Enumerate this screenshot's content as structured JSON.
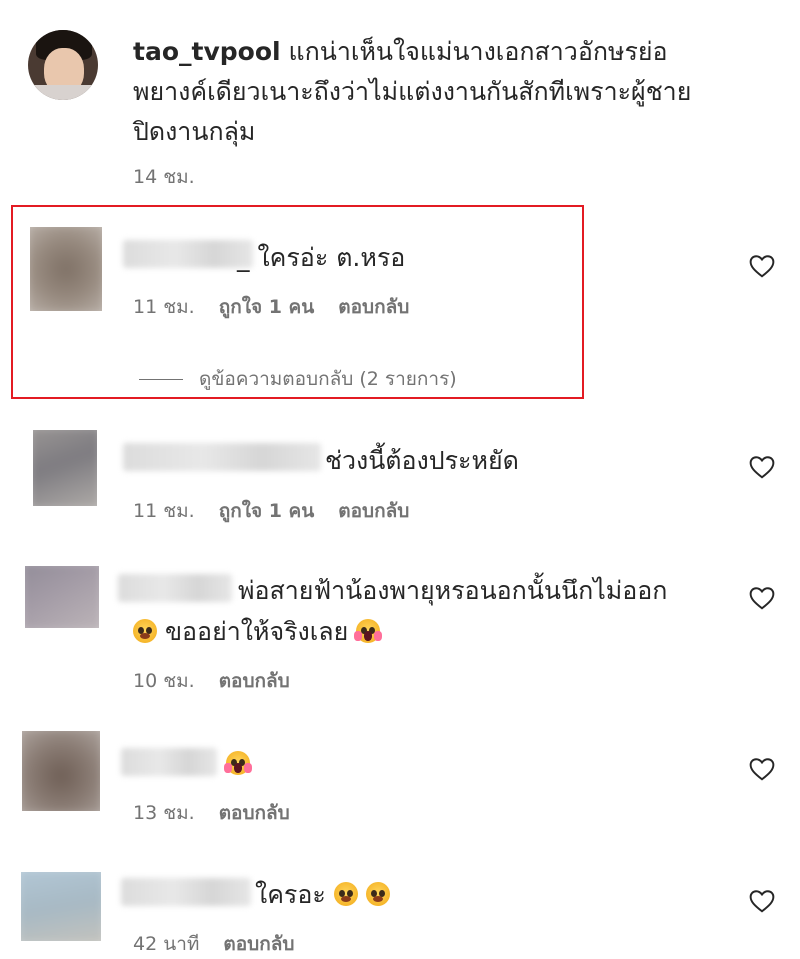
{
  "comments": [
    {
      "username": "tao_tvpool",
      "text_lines": [
        "แกน่าเห็นใจแม่นางเอกสาวอักษรย่อ",
        "พยางค์เดียวเนาะถึงว่าไม่แต่งงานกันสักทีเพราะผู้ชาย",
        "ปิดงานกลุ่ม"
      ],
      "time": "14 ชม."
    },
    {
      "text": "_ ใครอ่ะ ต.หรอ",
      "time": "11 ชม.",
      "likes": "ถูกใจ 1 คน",
      "reply": "ตอบกลับ",
      "view_replies": "ดูข้อความตอบกลับ (2 รายการ)"
    },
    {
      "text": "ช่วงนี้ต้องประหยัด",
      "time": "11 ชม.",
      "likes": "ถูกใจ 1 คน",
      "reply": "ตอบกลับ"
    },
    {
      "text_line1": "พ่อสายฟ้าน้องพายุหรอนอกนั้นนึกไม่ออก",
      "text_line2": "ขออย่าให้จริงเลย",
      "time": "10 ชม.",
      "reply": "ตอบกลับ"
    },
    {
      "time": "13 ชม.",
      "reply": "ตอบกลับ"
    },
    {
      "text": "ใครอะ",
      "time": "42 นาที",
      "reply": "ตอบกลับ"
    }
  ],
  "icons": {
    "like": "heart-outline-icon"
  },
  "colors": {
    "highlight_border": "#e31b23",
    "meta_text": "#737373"
  }
}
